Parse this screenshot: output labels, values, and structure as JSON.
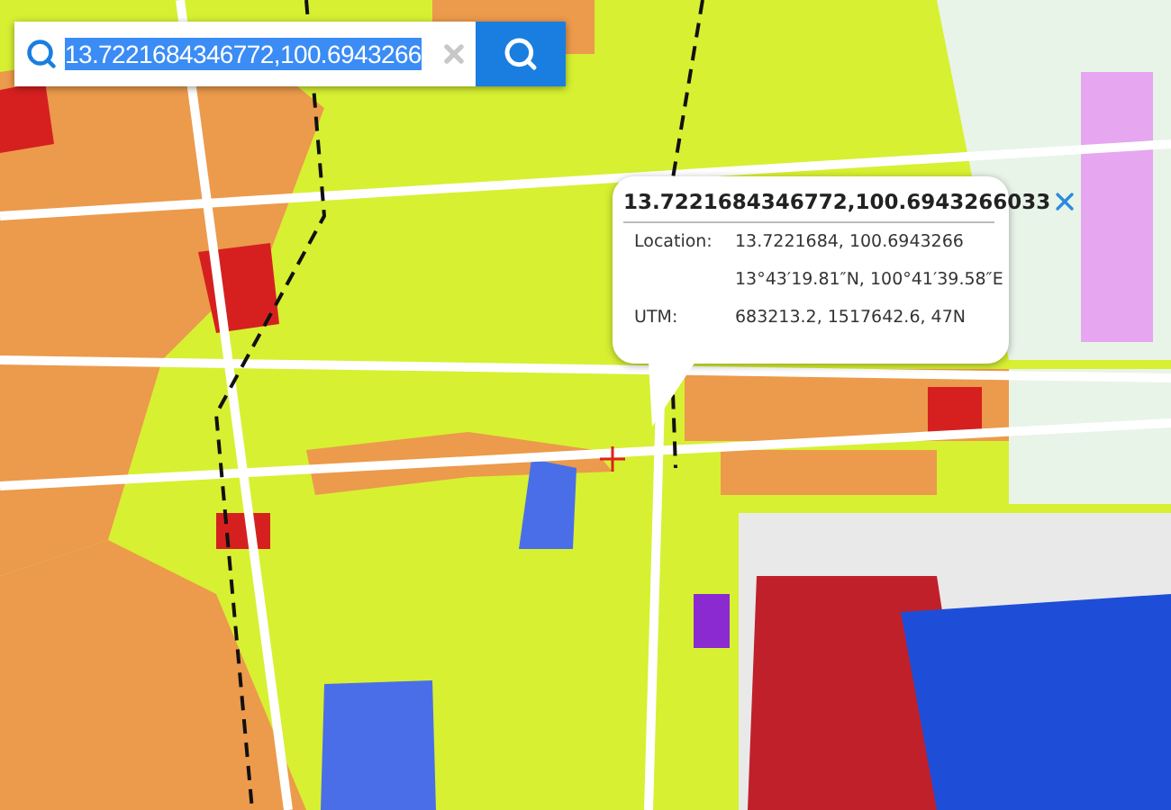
{
  "search": {
    "value": "13.7221684346772,100.6943266",
    "selected": true
  },
  "popup": {
    "title": "13.7221684346772,100.6943266033",
    "rows": [
      {
        "label": "Location:",
        "value": "13.7221684, 100.6943266"
      },
      {
        "value": "13°43′19.81″N, 100°41′39.58″E"
      },
      {
        "label": "UTM:",
        "value": "683213.2, 1517642.6, 47N"
      }
    ]
  }
}
